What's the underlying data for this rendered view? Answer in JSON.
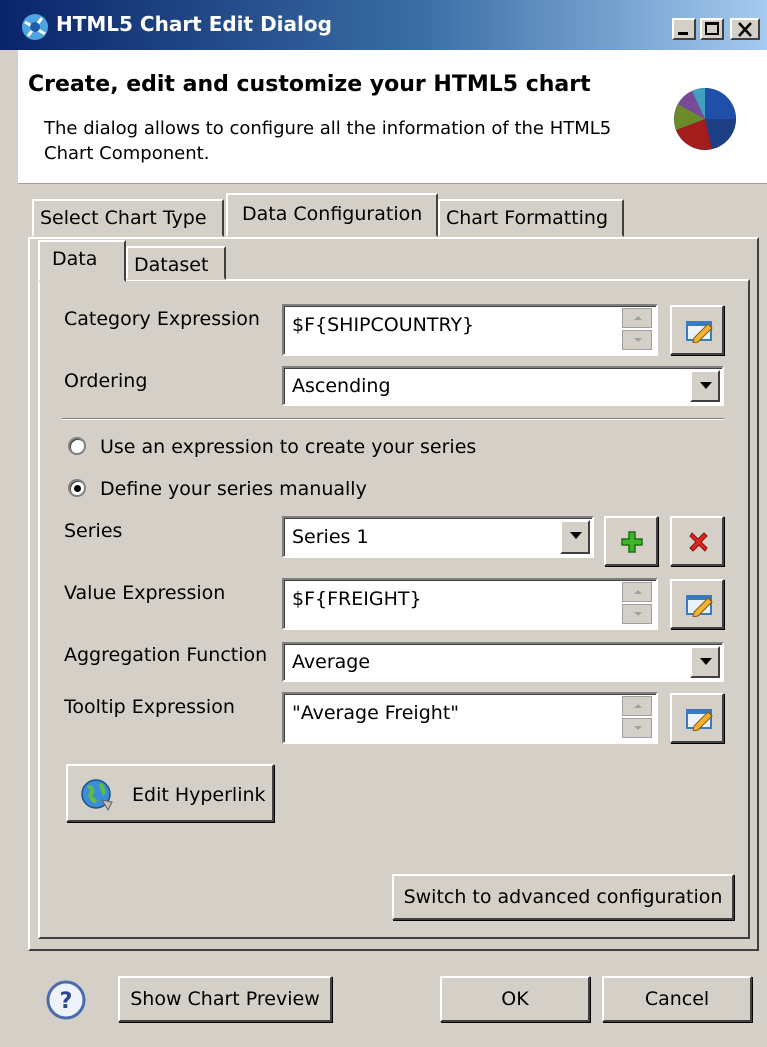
{
  "window": {
    "title": "HTML5 Chart Edit Dialog",
    "icon": "chart-wizard-icon",
    "controls": [
      "minimize-icon",
      "maximize-icon",
      "close-icon"
    ]
  },
  "header": {
    "title": "Create, edit and customize your HTML5 chart",
    "description": "The dialog allows to configure all the information of the HTML5 Chart Component.",
    "icon": "pie-chart-icon"
  },
  "tabs": {
    "select_chart_type": "Select Chart Type",
    "data_configuration": "Data Configuration",
    "chart_formatting": "Chart Formatting",
    "active": "Data Configuration"
  },
  "subtabs": {
    "data": "Data",
    "dataset": "Dataset",
    "active": "Data"
  },
  "form": {
    "category_label": "Category Expression",
    "category_value": "$F{SHIPCOUNTRY}",
    "ordering_label": "Ordering",
    "ordering_value": "Ascending",
    "radio_expression": "Use an expression to create your series",
    "radio_manual": "Define your series manually",
    "radio_selected": "manual",
    "series_label": "Series",
    "series_value": "Series 1",
    "value_label": "Value Expression",
    "value_value": "$F{FREIGHT}",
    "aggregation_label": "Aggregation Function",
    "aggregation_value": "Average",
    "tooltip_label": "Tooltip Expression",
    "tooltip_value": "\"Average Freight\"",
    "edit_hyperlink": "Edit Hyperlink",
    "advanced": "Switch to advanced configuration"
  },
  "footer": {
    "help_icon": "help-icon",
    "preview": "Show Chart Preview",
    "ok": "OK",
    "cancel": "Cancel"
  },
  "colors": {
    "title_bar_start": "#0a246a",
    "title_bar_end": "#a6caf0",
    "dialog_bg": "#d4d0c8",
    "add_icon": "#2e9e1f",
    "remove_icon": "#d11a1a"
  }
}
